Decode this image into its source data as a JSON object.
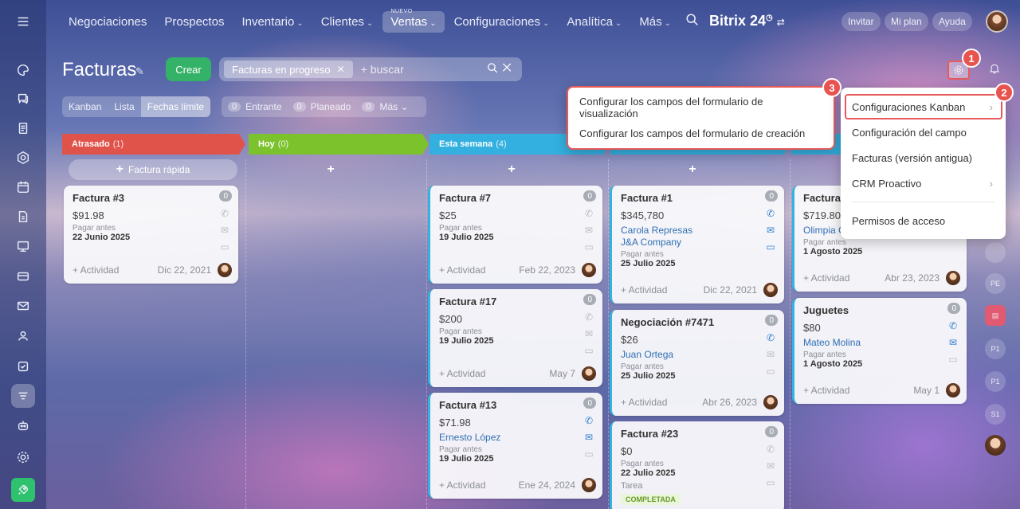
{
  "topnav": {
    "items": [
      {
        "label": "Negociaciones",
        "chevron": ""
      },
      {
        "label": "Prospectos",
        "chevron": ""
      },
      {
        "label": "Inventario",
        "chevron": "⌄"
      },
      {
        "label": "Clientes",
        "chevron": "⌄"
      },
      {
        "label": "Ventas",
        "chevron": "⌄",
        "badge": "NUEVO",
        "active": true
      },
      {
        "label": "Configuraciones",
        "chevron": "⌄"
      },
      {
        "label": "Analítica",
        "chevron": "⌄"
      },
      {
        "label": "Más",
        "chevron": "⌄"
      }
    ],
    "brand": "Bitrix 24",
    "brand_mark": "◷",
    "invite": "Invitar",
    "my_plan": "Mi plan",
    "help": "Ayuda"
  },
  "header": {
    "title": "Facturas",
    "create_label": "Crear",
    "filter_tag": "Facturas en progreso",
    "search_placeholder": "+ buscar"
  },
  "views": [
    "Kanban",
    "Lista",
    "Fechas límite"
  ],
  "active_view": "Fechas límite",
  "counters": [
    {
      "num": "0",
      "label": "Entrante"
    },
    {
      "num": "0",
      "label": "Planeado"
    },
    {
      "num": "0",
      "label": "Más ⌄"
    }
  ],
  "columns": [
    {
      "title": "Atrasado",
      "count": "(1)",
      "color": "#e0534a",
      "quick_add": "Factura rápida"
    },
    {
      "title": "Hoy",
      "count": "(0)",
      "color": "#7bc22c"
    },
    {
      "title": "Esta semana",
      "count": "(4)",
      "color": "#33b0df"
    },
    {
      "title": "",
      "count": "",
      "color": "#33b0df"
    },
    {
      "title": "",
      "count": "",
      "color": "#33b0df"
    }
  ],
  "cards": {
    "c3": {
      "title": "Factura #3",
      "amount": "$91.98",
      "pay_label": "Pagar antes",
      "date": "22 Junio 2025",
      "count": "0",
      "activity": "+ Actividad",
      "created": "Dic 22, 2021"
    },
    "c7": {
      "title": "Factura #7",
      "amount": "$25",
      "pay_label": "Pagar antes",
      "date": "19 Julio 2025",
      "count": "0",
      "activity": "+ Actividad",
      "created": "Feb 22, 2023"
    },
    "c17": {
      "title": "Factura #17",
      "amount": "$200",
      "pay_label": "Pagar antes",
      "date": "19 Julio 2025",
      "count": "0",
      "activity": "+ Actividad",
      "created": "May 7"
    },
    "c13": {
      "title": "Factura #13",
      "amount": "$71.98",
      "client": "Ernesto López",
      "pay_label": "Pagar antes",
      "date": "19 Julio 2025",
      "count": "0",
      "activity": "+ Actividad",
      "created": "Ene 24, 2024"
    },
    "c1": {
      "title": "Factura #1",
      "amount": "$345,780",
      "client": "Carola Represas",
      "company": "J&A Company",
      "pay_label": "Pagar antes",
      "date": "25 Julio 2025",
      "count": "0",
      "activity": "+ Actividad",
      "created": "Dic 22, 2021"
    },
    "n7471": {
      "title": "Negociación #7471",
      "amount": "$26",
      "client": "Juan Ortega",
      "pay_label": "Pagar antes",
      "date": "25 Julio 2025",
      "count": "0",
      "activity": "+ Actividad",
      "created": "Abr 26, 2023"
    },
    "c23": {
      "title": "Factura #23",
      "amount": "$0",
      "pay_label": "Pagar antes",
      "date": "22 Julio 2025",
      "count": "0",
      "task_label": "Tarea",
      "badge": "COMPLETADA"
    },
    "c5": {
      "title": "Factura #",
      "amount": "$719.80",
      "client": "Olimpia C",
      "pay_label": "Pagar antes",
      "date": "1 Agosto 2025",
      "count": "0",
      "activity": "+ Actividad",
      "created": "Abr 23, 2023"
    },
    "jug": {
      "title": "Juguetes",
      "amount": "$80",
      "client": "Mateo Molina",
      "pay_label": "Pagar antes",
      "date": "1 Agosto 2025",
      "count": "0",
      "activity": "+ Actividad",
      "created": "May 1"
    }
  },
  "left_menu": {
    "items": [
      "Configurar los campos del formulario de visualización",
      "Configurar los campos del formulario de creación"
    ]
  },
  "right_menu": {
    "items": [
      "Configuraciones Kanban",
      "Configuración del campo",
      "Facturas (versión antigua)",
      "CRM Proactivo",
      "Permisos de acceso"
    ]
  },
  "markers": [
    "1",
    "2",
    "3"
  ],
  "right_rail": [
    "PE",
    "P1",
    "P1",
    "S1"
  ],
  "icons": [
    "menu-icon",
    "search-icon",
    "gear-icon",
    "bell-icon",
    "pin-icon",
    "phone-icon",
    "mail-icon",
    "chat-icon",
    "rocket-icon"
  ]
}
